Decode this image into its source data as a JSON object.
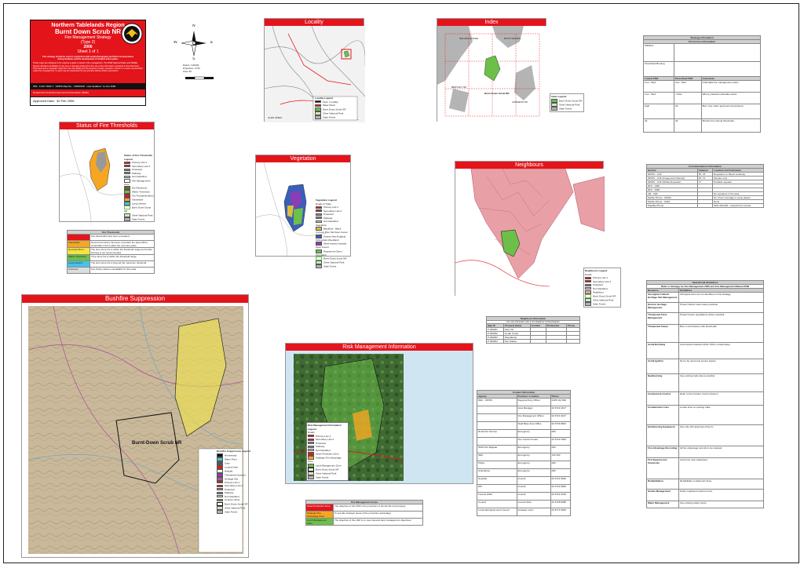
{
  "title_block": {
    "region": "Northern Tablelands Region",
    "reserve": "Burnt Down Scrub NR",
    "strategy": "Fire Management Strategy",
    "type": "(Type 2)",
    "year": "2006",
    "sheet": "Sheet 1 of 1",
    "line1": "This strategy should be used in conjunction with aerial photography and field reconnaissance",
    "line2": "during incidents and the development of incident action plans.",
    "para": "These maps are designed to be used as a guide to assist in fire management. The NSW National Parks and Wildlife Service disclaims all liability for any loss or damage arising from the use of the information contained in this document. This document is copyright. Apart from any fair dealing for the purpose of study, research, criticism or review, as permitted under the Copyright Act, no part may be reproduced by any process without written permission.",
    "ims_label": "IMS : 11417 NW2-7",
    "map_label": "NPWS Map No. : NWS0106",
    "last_updated": "Last Updated : 11 Jan 2006",
    "approved_label": "Approved Date:",
    "approved_date": "30 Feb 2006",
    "dept": "Department of Environment and Conservation (NSW)"
  },
  "compass": {
    "n": "N",
    "s": "S",
    "e": "E",
    "w": "W",
    "note1": "Datum: GDA94",
    "note2": "Projection: UTM",
    "note3": "Zone 56"
  },
  "locality": {
    "title": "Locality",
    "legend_title": "Locality Legend",
    "legend": [
      "Town / Locality",
      "Major Road",
      "Burnt Down Scrub NR",
      "Other National Park",
      "State Forest"
    ],
    "label": "GLEN INNES"
  },
  "index": {
    "title": "Index",
    "legend_title": "Index Legend",
    "legend": [
      "Burnt Down Scrub NR",
      "Other National Park",
      "State Forest"
    ],
    "labels": [
      "MALARA GORGE",
      "BOYD WOODS",
      "BENTLEY NR",
      "CARDENS NR"
    ],
    "reserve_label": "Burnt Down Scrub NR"
  },
  "fire_threshold": {
    "title": "Status of Fire Thresholds",
    "legend_title": "Status of Fire Thresholds Legend",
    "legend": [
      "Primary Link 1",
      "Secondary Link 2",
      "Protected",
      "Pathway",
      "Not Classified",
      "Fire Management Zone",
      "Dry Rainforest",
      "Within Threshold",
      "Too Frequently Burnt",
      "Vulnerable",
      "Long Unburnt",
      "Burnt Down Scrub NR",
      "Other National Park",
      "State Forest"
    ]
  },
  "fire_thresholds_table": {
    "title": "Fire Thresholds",
    "rows": [
      {
        "label": "",
        "text": "Fire thresholds have been exceeded"
      },
      {
        "label": "Vulnerable",
        "text": "Recent fire history has been recorded; the area will be vulnerable if burnt within the next few years."
      },
      {
        "label": "Recently Burnt",
        "text": "The time since fire is within the threshold range and further burning is not recommended."
      },
      {
        "label": "Within Threshold",
        "text": "Time since fire is within the threshold range."
      },
      {
        "label": "Long Unburnt",
        "text": "The time since fire is beyond the maximum threshold."
      },
      {
        "label": "Unknown",
        "text": "Fire history data is unavailable for this area."
      }
    ]
  },
  "vegetation": {
    "title": "Vegetation",
    "legend_title": "Vegetation Legend",
    "legend": [
      "Roads & Trails",
      "Primary Link 1",
      "Secondary Link 2",
      "Protected",
      "Pathway",
      "Not Classified",
      "Vegetation",
      "Blackbutt - Black Cypress Pine Tall Open Forest",
      "Grassy New England Stringybark Woodland",
      "Silver-leaved Ironbark Open Forest",
      "Peppermint Open Woodland",
      "Burnt Down Scrub NR",
      "Other National Park",
      "State Forest"
    ]
  },
  "neighbours": {
    "title": "Neighbours",
    "legend_title": "Neighbours Legend",
    "legend": [
      "Roads",
      "Primary Link 1",
      "Secondary Link 2",
      "Protected",
      "Not Classified",
      "Neighbour",
      "Burnt Down Scrub NR",
      "Other National Park",
      "State Forest"
    ]
  },
  "neighbour_table": {
    "title": "Neighbour Information",
    "note": "For more information refer to the Neighbour Contact Register",
    "headers": [
      "Map ID",
      "Property Name",
      "Contact",
      "Ph Number",
      "Phone"
    ],
    "rows": [
      [
        "P 000001",
        "Glen Orr",
        "",
        "",
        ""
      ],
      [
        "P 000002",
        "Cedar Creek",
        "",
        "",
        ""
      ],
      [
        "P 000003",
        "Woodlands",
        "",
        "",
        ""
      ],
      [
        "P 000004",
        "Fire Station",
        "",
        "",
        ""
      ]
    ]
  },
  "suppression": {
    "title": "Bushfire Suppression",
    "reserve_label": "Burnt-Down Scrub NR",
    "legend_title": "Bushfire Suppression Legend",
    "legend": [
      "Homestead",
      "Water Point",
      "Gate",
      "Locked Gate",
      "Helipad",
      "Threatened Species",
      "Heritage Site",
      "Primary Link 1",
      "Secondary Link 2",
      "Protected",
      "Pathway",
      "Not Classified",
      "Contour (10m)",
      "Burnt Down Scrub NR",
      "Other National Park",
      "State Forest"
    ]
  },
  "risk": {
    "title": "Risk Management Information",
    "legend_title": "Risk Management Information Legend",
    "legend": [
      "Roads",
      "Primary Link 1",
      "Secondary Link 2",
      "Protected",
      "Pathway",
      "Not Classified",
      "Asset Protection Zone",
      "Strategic Fire Advantage Zone",
      "Land Management Zone",
      "Burnt Down Scrub NR",
      "Other National Park",
      "State Forest"
    ]
  },
  "zones_table": {
    "title": "Fire Management Zones",
    "rows": [
      {
        "label": "Asset Protection Zone",
        "text": "The objective of the APZ is the protection of human life and property."
      },
      {
        "label": "Strategic Fire Advantage Zone",
        "text": "To provide strategic areas of fire protection advantage."
      },
      {
        "label": "Land Management Zone",
        "text": "The objective of the LMZ is to meet relevant land management objectives."
      }
    ]
  },
  "strategy_table": {
    "title": "Strategy Information",
    "subtitle": "Fire Access Information",
    "headers": [
      "Lowest FMZ",
      "Prescribed FMZ",
      "Comments"
    ],
    "rows": [
      [
        "Low - Mod",
        "Low - Mod",
        "Undertake fire management works"
      ],
      [
        "Low - Mod",
        "> Mod",
        "Where practical undertake works"
      ],
      [
        "High",
        "All",
        "Burn only under approved prescriptions"
      ],
      [
        "All",
        "All",
        "Monitor fire interval thresholds"
      ]
    ],
    "left_labels": [
      "Wildfires",
      "Prescribed Burning"
    ]
  },
  "comms_table": {
    "title": "Communications Information",
    "headers": [
      "Service",
      "Channel",
      "Location and Comments"
    ],
    "rows": [
      [
        "NPWS - VHF",
        "55, 78",
        "Repeaters on Mount Lindesay"
      ],
      [
        "NPWS - VHF (Fireground Channel)",
        "53, 72",
        "Simplex only"
      ],
      [
        "NPWS - VHF (Mobile Repeater)",
        "77",
        "Portable repeater"
      ],
      [
        "RFS - GRN",
        "",
        ""
      ],
      [
        "RFS - PMR",
        "",
        ""
      ],
      [
        "CB - UHF",
        "",
        "No repeaters in the area"
      ],
      [
        "Mobile Phone - CDMA",
        "",
        "No / Poor coverage in some places"
      ],
      [
        "Mobile Phone - GSM",
        "",
        "None"
      ],
      [
        "Satellite Phone",
        "",
        "0101 000 000 - Inverell Fire Control"
      ]
    ]
  },
  "operational_table": {
    "title": "Operational Guidelines",
    "subtitle": "Refer to Strategy for Fire Management 2006 and Fire Management Manual 2006",
    "headers": [
      "Resource",
      "Guidelines"
    ],
    "rows": [
      [
        "Aboriginal Cultural Heritage Site Management",
        "Aboriginal sites are not identified on this strategy."
      ],
      [
        "Historic Heritage Management",
        "Protect historic sites where practical."
      ],
      [
        "Threatened Flora Management",
        "Protect known populations where practical."
      ],
      [
        "Threatened Fauna",
        "Burn in accordance with thresholds."
      ],
      [
        "Aerial Bombing",
        "Avoid aerial retardant within 100m of waterways."
      ],
      [
        "Aerial Ignition",
        "Not to be used near known assets."
      ],
      [
        "Backburning",
        "Use existing trails where possible."
      ],
      [
        "Command & Control",
        "Refer to the Incident Control System."
      ],
      [
        "Containment Lines",
        "Locate lines on existing trails."
      ],
      [
        "Earthmoving Equipment",
        "Use only with approval of the IC."
      ],
      [
        "Fire Advantage Recording",
        "All fire advantage records to be retained."
      ],
      [
        "Fire Suppression Chemicals",
        "Avoid use near waterways."
      ],
      [
        "Rehabilitation",
        "Rehabilitate containment lines."
      ],
      [
        "Smoke Management",
        "Notify neighbours before burns."
      ],
      [
        "Water Management",
        "Use existing water points."
      ]
    ]
  },
  "contact_table": {
    "title": "Contact Information",
    "headers": [
      "Agency",
      "Position / Location",
      "Phone"
    ],
    "rows": [
      [
        "DEC - NPWS",
        "Regional Duty Officer",
        "0428 191 990"
      ],
      [
        "",
        "Area Manager",
        "02 6721 0107"
      ],
      [
        "",
        "Fire Management Officer",
        "02 6721 0107"
      ],
      [
        "",
        "Field Base Area Office",
        "02 6739 0822"
      ],
      [
        "Rural Fire Service",
        "Emergency",
        "000"
      ],
      [
        "",
        "Fire Control Centre",
        "02 6722 2000"
      ],
      [
        "NSW Fire Brigade",
        "Emergency",
        "000"
      ],
      [
        "SES",
        "Emergency",
        "132 500"
      ],
      [
        "Police",
        "Emergency",
        "000"
      ],
      [
        "Ambulance",
        "Emergency",
        "000"
      ],
      [
        "Hospital",
        "Inverell",
        "02 6721 9500"
      ],
      [
        "DPI",
        "Inverell",
        "02 6722 9800"
      ],
      [
        "Forests NSW",
        "Inverell",
        "02 6722 2155"
      ],
      [
        "Council",
        "Inverell Shire",
        "02 6728 8288"
      ],
      [
        "Local Aboriginal Land Council",
        "Anaiwan LALC",
        "02 6771 5000"
      ]
    ]
  },
  "colors": {
    "red": "#e4141b",
    "pink": "#e8a0a6",
    "green": "#6cc04a",
    "grey": "#b4b4b4",
    "gold": "#f2c20f"
  }
}
